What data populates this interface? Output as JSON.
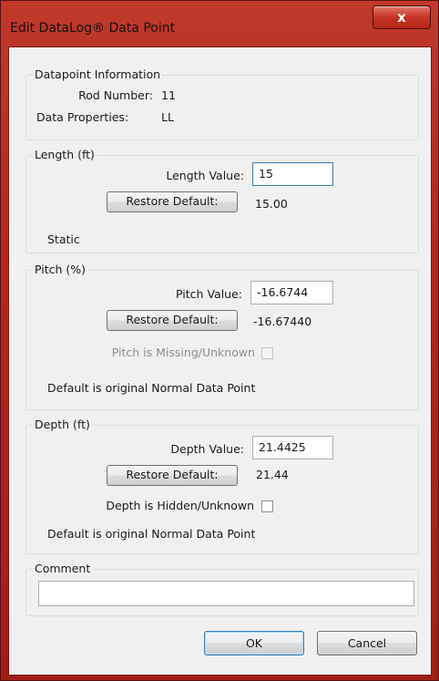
{
  "window": {
    "title": "Edit DataLog® Data Point",
    "close_glyph": "x"
  },
  "datapoint_info": {
    "legend": "Datapoint Information",
    "rod_number_label": "Rod Number:",
    "rod_number_value": "11",
    "data_properties_label": "Data Properties:",
    "data_properties_value": "LL"
  },
  "length": {
    "legend": "Length (ft)",
    "value_label": "Length Value:",
    "value": "15",
    "restore_label": "Restore Default:",
    "default_value": "15.00",
    "status": "Static"
  },
  "pitch": {
    "legend": "Pitch (%)",
    "value_label": "Pitch Value:",
    "value": "-16.6744",
    "restore_label": "Restore Default:",
    "default_value": "-16.67440",
    "missing_label": "Pitch is Missing/Unknown",
    "missing_checked": false,
    "note": "Default is original Normal Data Point"
  },
  "depth": {
    "legend": "Depth (ft)",
    "value_label": "Depth Value:",
    "value": "21.4425",
    "restore_label": "Restore Default:",
    "default_value": "21.44",
    "hidden_label": "Depth is Hidden/Unknown",
    "hidden_checked": false,
    "note": "Default is original Normal Data Point"
  },
  "comment": {
    "legend": "Comment",
    "value": ""
  },
  "buttons": {
    "ok_label": "OK",
    "cancel_label": "Cancel"
  },
  "colors": {
    "frame": "#b3261e",
    "client_bg": "#f0f0f0",
    "focus_border": "#3c7fb1"
  }
}
